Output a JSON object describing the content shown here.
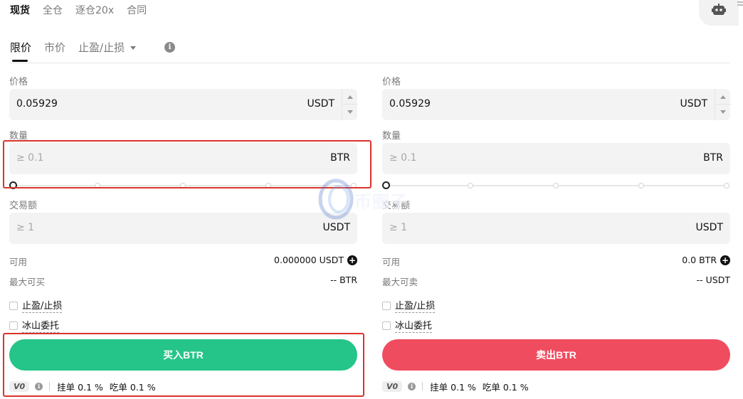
{
  "top_tabs": [
    "现货",
    "全仓",
    "逐仓20x",
    "合同"
  ],
  "sub_tabs": {
    "limit": "限价",
    "market": "市价",
    "tp_sl": "止盈/止损"
  },
  "buy": {
    "price_label": "价格",
    "price_value": "0.05929",
    "price_unit": "USDT",
    "amount_label": "数量",
    "amount_placeholder": "≥ 0.1",
    "amount_unit": "BTR",
    "total_label": "交易额",
    "total_placeholder": "≥ 1",
    "total_unit": "USDT",
    "available_label": "可用",
    "available_value": "0.000000 USDT",
    "max_label": "最大可买",
    "max_value": "-- BTR",
    "tp_sl_label": "止盈/止损",
    "iceberg_label": "冰山委托",
    "button_label": "买入BTR"
  },
  "sell": {
    "price_label": "价格",
    "price_value": "0.05929",
    "price_unit": "USDT",
    "amount_label": "数量",
    "amount_placeholder": "≥ 0.1",
    "amount_unit": "BTR",
    "total_label": "交易额",
    "total_placeholder": "≥ 1",
    "total_unit": "USDT",
    "available_label": "可用",
    "available_value": "0.0 BTR",
    "max_label": "最大可卖",
    "max_value": "-- USDT",
    "tp_sl_label": "止盈/止损",
    "iceberg_label": "冰山委托",
    "button_label": "卖出BTR"
  },
  "fees": {
    "vip": "V0",
    "maker": "挂单 0.1 %",
    "taker": "吃单 0.1 %"
  },
  "slider_percent": 0,
  "watermark_text": "币圈子",
  "colors": {
    "buy": "#25c488",
    "sell": "#f04c60",
    "highlight": "#d9332e"
  },
  "icons": {
    "robot": "robot-icon",
    "info": "info-icon",
    "plus": "plus-icon"
  }
}
